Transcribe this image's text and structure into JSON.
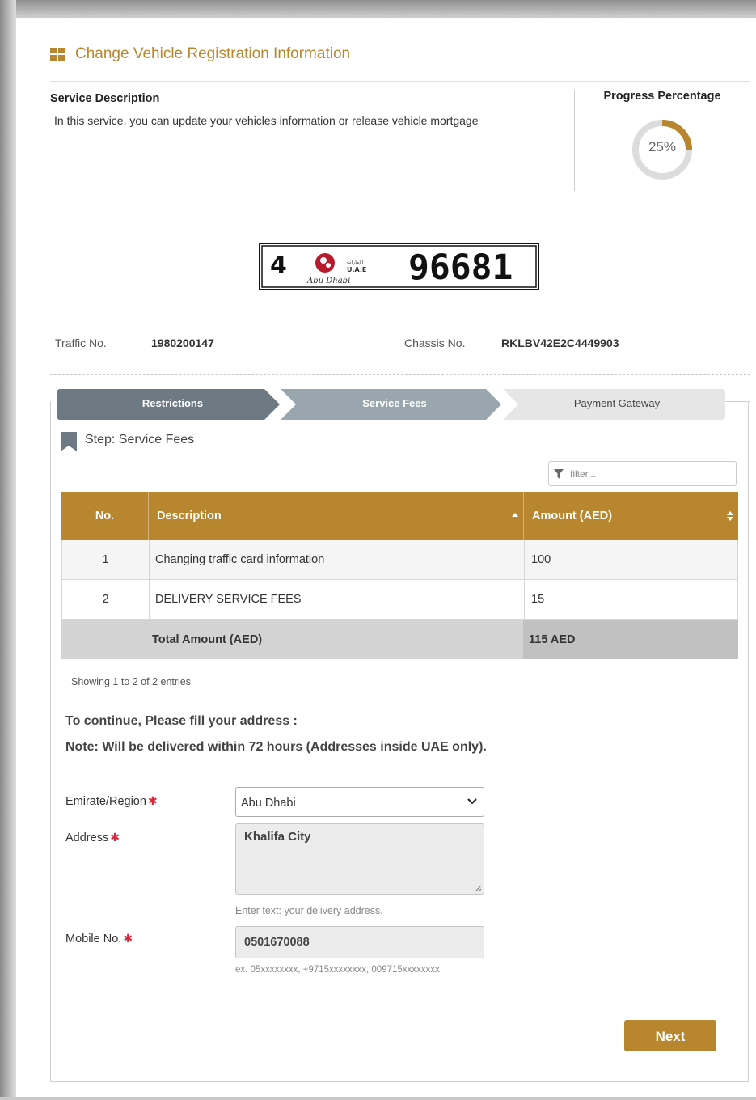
{
  "page": {
    "title": "Change Vehicle Registration Information"
  },
  "service": {
    "label": "Service Description",
    "text": "In this service, you can update your vehicles information or release vehicle mortgage"
  },
  "progress": {
    "label": "Progress Percentage",
    "percent": 25,
    "text": "25%",
    "color": "#b8862e"
  },
  "plate": {
    "code": "4",
    "emirate": "Abu Dhabi",
    "country_ar": "الإمارات",
    "country": "U.A.E",
    "number": "96681"
  },
  "vehicle": {
    "traffic_label": "Traffic No.",
    "traffic_value": "1980200147",
    "chassis_label": "Chassis No.",
    "chassis_value": "RKLBV42E2C4449903"
  },
  "wizard": {
    "steps": [
      "Restrictions",
      "Service Fees",
      "Payment Gateway"
    ],
    "current_step": "Step: Service Fees"
  },
  "filter": {
    "placeholder": "filter..."
  },
  "table": {
    "headers": [
      "No.",
      "Description",
      "Amount (AED)"
    ],
    "rows": [
      {
        "no": "1",
        "description": "Changing traffic card information",
        "amount": "100"
      },
      {
        "no": "2",
        "description": "DELIVERY SERVICE FEES",
        "amount": "15"
      }
    ],
    "total_label": "Total Amount (AED)",
    "total_value": "115 AED",
    "showing": "Showing 1 to 2 of 2 entries"
  },
  "notes": {
    "line1": "To continue, Please fill your address :",
    "line2": "Note: Will be delivered within 72 hours (Addresses inside UAE only)."
  },
  "form": {
    "emirate_label": "Emirate/Region",
    "emirate_value": "Abu Dhabi",
    "address_label": "Address",
    "address_value": "Khalifa City",
    "address_hint": "Enter text: your delivery address.",
    "mobile_label": "Mobile No.",
    "mobile_value": "0501670088",
    "mobile_hint": "ex. 05xxxxxxxx, +9715xxxxxxxx, 009715xxxxxxxx",
    "required_mark": "✱"
  },
  "actions": {
    "next_label": "Next"
  },
  "colors": {
    "accent": "#b8862e",
    "step_done": "#6e7a83",
    "step_active": "#9aa6ad",
    "step_pending": "#e6e6e6"
  }
}
